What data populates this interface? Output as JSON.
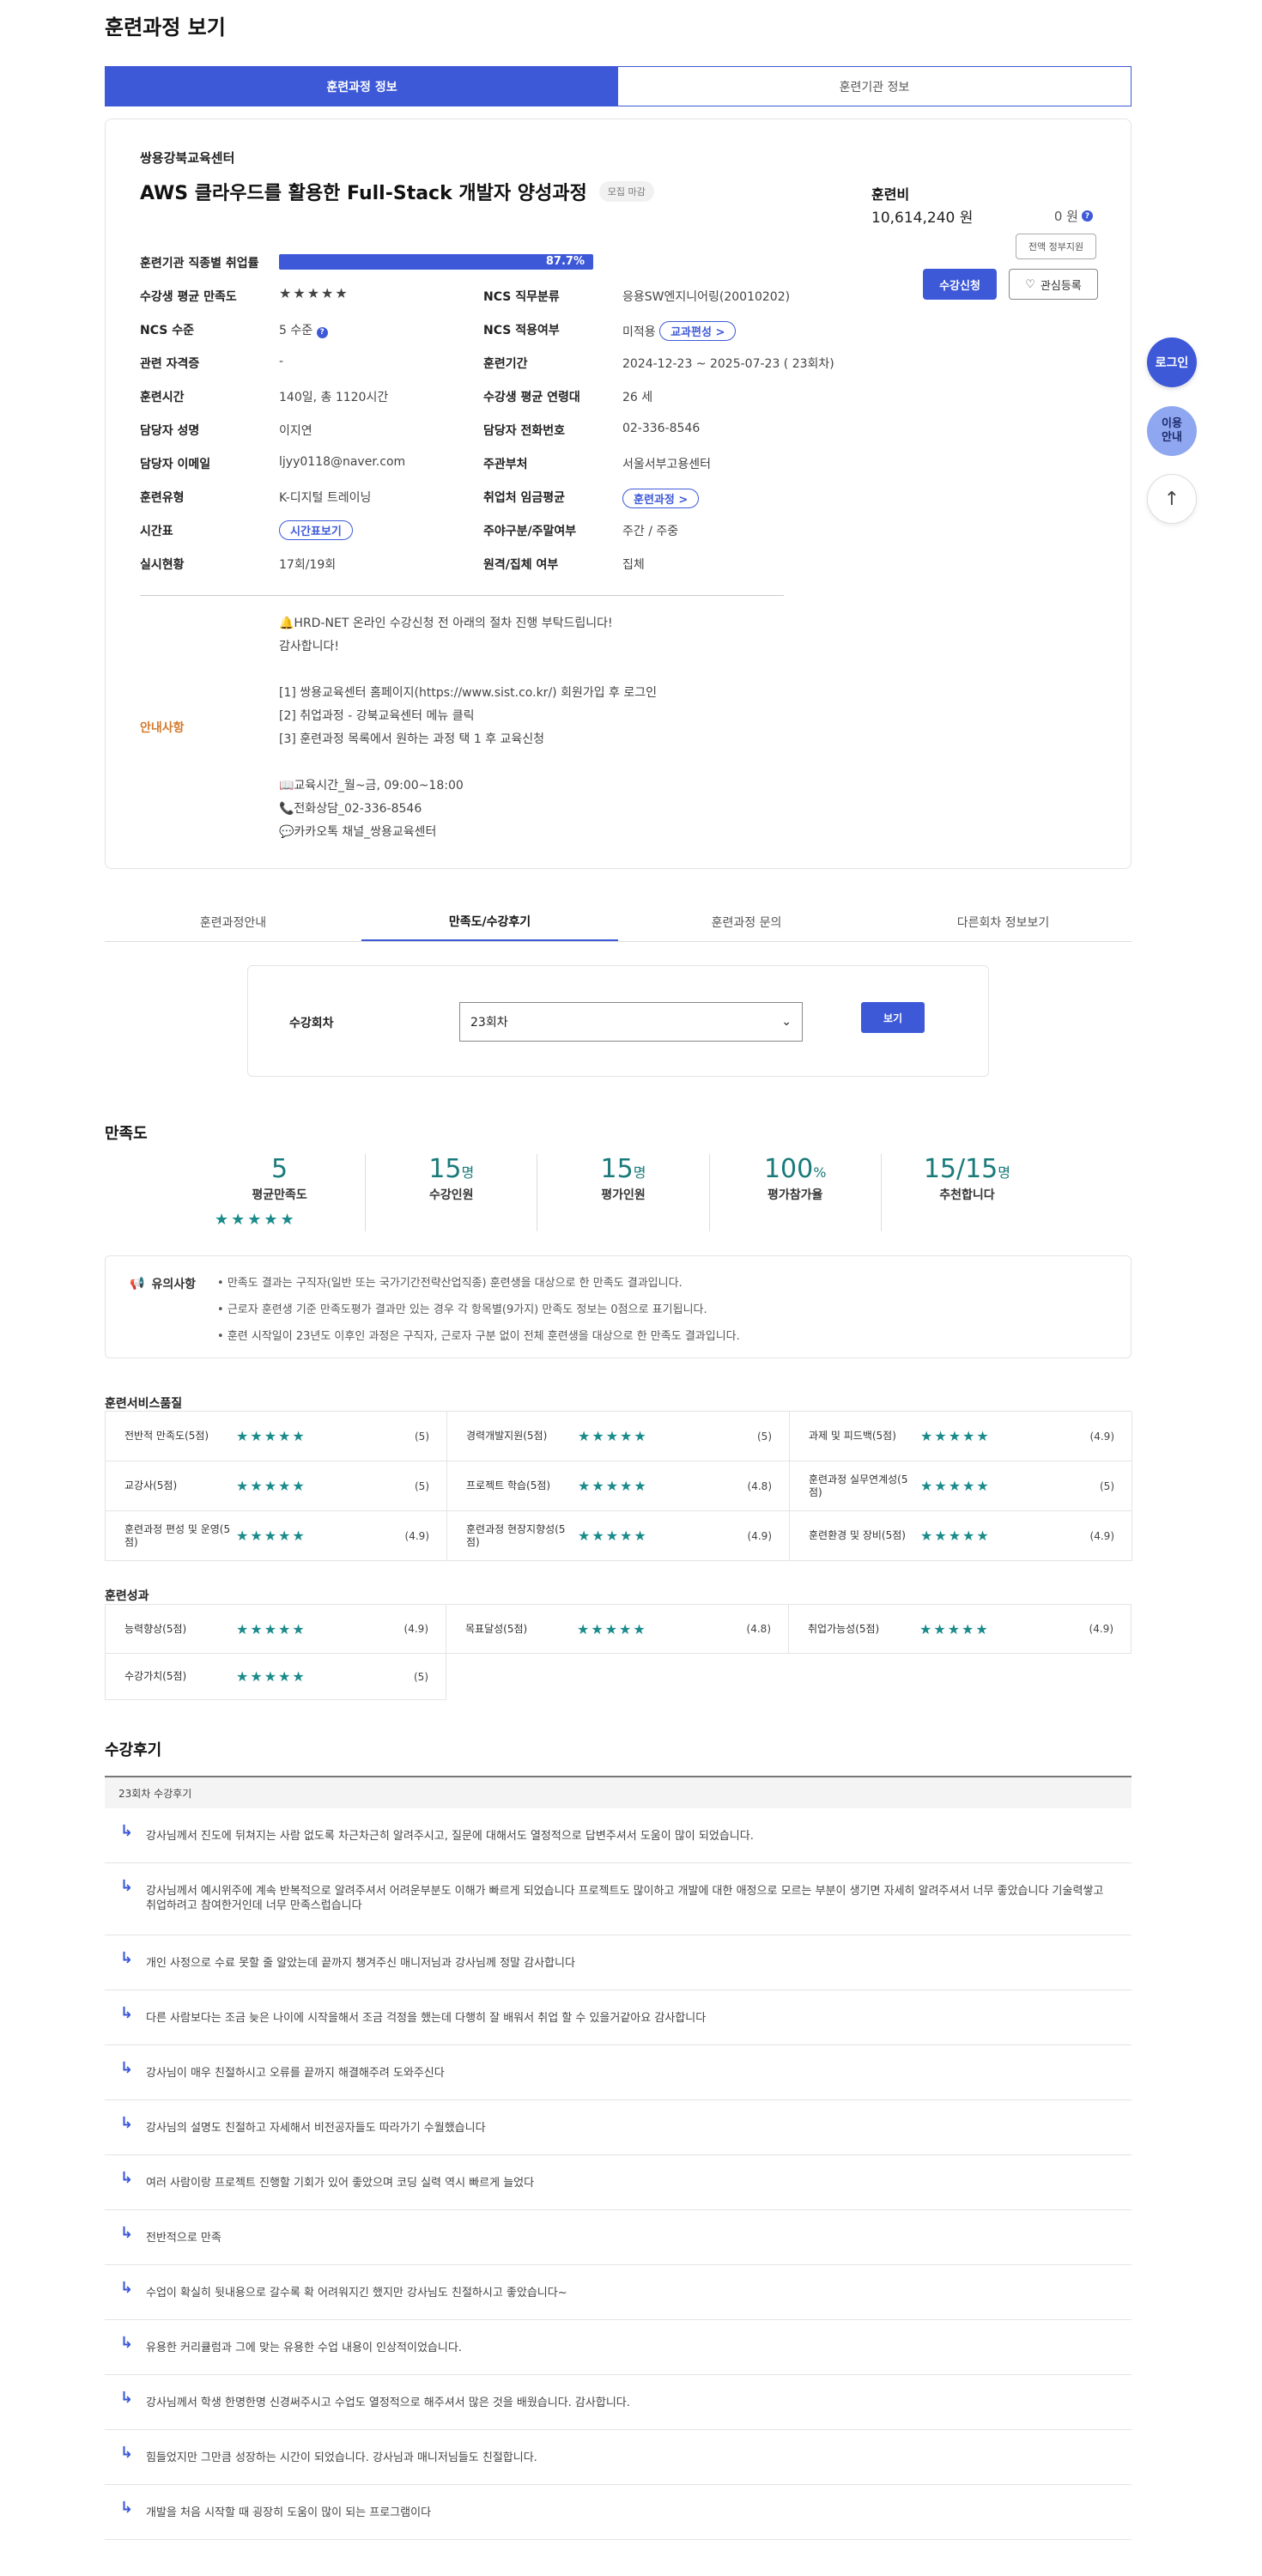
{
  "page_title": "훈련과정 보기",
  "top_tabs": [
    {
      "label": "훈련과정 정보",
      "active": true
    },
    {
      "label": "훈련기관 정보",
      "active": false
    }
  ],
  "course": {
    "org": "쌍용강북교육센터",
    "title": "AWS 클라우드를 활용한 Full-Stack 개발자 양성과정",
    "status_badge": "모집 마감",
    "fee_label": "훈련비",
    "fee_value": "10,614,240 원",
    "self_pay": "0 원",
    "full_support_label": "전액 정부지원",
    "apply_label": "수강신청",
    "fav_label": "관심등록"
  },
  "details": {
    "employment_rate_label": "훈련기관 직종별 취업률",
    "employment_rate": "87.7%",
    "employment_rate_value": 87.7,
    "satisfaction_label": "수강생 평균 만족도",
    "satisfaction_stars": "★★★★★",
    "ncs_field_label": "NCS 직무분류",
    "ncs_field": "응용SW엔지니어링(20010202)",
    "ncs_level_label": "NCS 수준",
    "ncs_level": "5 수준",
    "ncs_apply_label": "NCS 적용여부",
    "ncs_apply": "미적용",
    "curriculum_pill": "교과편성 >",
    "license_label": "관련 자격증",
    "license": "-",
    "period_label": "훈련기간",
    "period": "2024-12-23 ~ 2025-07-23 ( 23회차)",
    "hours_label": "훈련시간",
    "hours": "140일, 총 1120시간",
    "age_label": "수강생 평균 연령대",
    "age": "26 세",
    "manager_label": "담당자 성명",
    "manager": "이지연",
    "phone_label": "담당자 전화번호",
    "phone": "02-336-8546",
    "email_label": "담당자 이메일",
    "email": "ljyy0118@naver.com",
    "dept_label": "주관부처",
    "dept": "서울서부고용센터",
    "type_label": "훈련유형",
    "type": "K-디지털 트레이닝",
    "wage_label": "취업처 임금평균",
    "wage_pill": "훈련과정 >",
    "schedule_label": "시간표",
    "schedule_pill": "시간표보기",
    "daynight_label": "주야구분/주말여부",
    "daynight": "주간 / 주중",
    "status_label": "실시현황",
    "status": "17회/19회",
    "remote_label": "원격/집체 여부",
    "remote": "집체"
  },
  "notice": {
    "label": "안내사항",
    "lines": [
      "🔔HRD-NET 온라인 수강신청 전 아래의 절차 진행 부탁드립니다!",
      "감사합니다!",
      "",
      "[1] 쌍용교육센터 홈페이지(https://www.sist.co.kr/) 회원가입 후 로그인",
      "[2] 취업과정 - 강북교육센터 메뉴 클릭",
      "[3] 훈련과정 목록에서 원하는 과정 택 1 후 교육신청",
      "",
      "📖교육시간_월~금, 09:00~18:00",
      "📞전화상담_02-336-8546",
      "💬카카오톡 채널_쌍용교육센터"
    ]
  },
  "section_tabs": [
    {
      "label": "훈련과정안내",
      "active": false
    },
    {
      "label": "만족도/수강후기",
      "active": true
    },
    {
      "label": "훈련과정 문의",
      "active": false
    },
    {
      "label": "다른회차 정보보기",
      "active": false
    }
  ],
  "filter": {
    "label": "수강회차",
    "selected": "23회차",
    "button": "보기"
  },
  "satisfaction": {
    "title": "만족도",
    "stats": [
      {
        "num": "5",
        "unit": "",
        "label": "평균만족도"
      },
      {
        "num": "15",
        "unit": "명",
        "label": "수강인원"
      },
      {
        "num": "15",
        "unit": "명",
        "label": "평가인원"
      },
      {
        "num": "100",
        "unit": "%",
        "label": "평가참가율"
      },
      {
        "num": "15/15",
        "unit": "명",
        "label": "추천합니다"
      }
    ],
    "stars": "★★★★★"
  },
  "caution": {
    "title": "유의사항",
    "items": [
      "만족도 결과는 구직자(일반 또는 국가기간전략산업직종) 훈련생을 대상으로 한 만족도 결과입니다.",
      "근로자 훈련생 기준 만족도평가 결과만 있는 경우 각 항목별(9가지) 만족도 정보는 0점으로 표기됩니다.",
      "훈련 시작일이 23년도 이후인 과정은 구직자, 근로자 구분 없이 전체 훈련생을 대상으로 한 만족도 결과입니다."
    ]
  },
  "service_quality": {
    "title": "훈련서비스품질",
    "items": [
      {
        "label": "전반적 만족도(5점)",
        "score": "(5)"
      },
      {
        "label": "경력개발지원(5점)",
        "score": "(5)"
      },
      {
        "label": "과제 및 피드백(5점)",
        "score": "(4.9)"
      },
      {
        "label": "교강사(5점)",
        "score": "(5)"
      },
      {
        "label": "프로젝트 학습(5점)",
        "score": "(4.8)"
      },
      {
        "label": "훈련과정 실무연계성(5점)",
        "score": "(5)"
      },
      {
        "label": "훈련과정 편성 및 운영(5점)",
        "score": "(4.9)"
      },
      {
        "label": "훈련과정 현장지향성(5점)",
        "score": "(4.9)"
      },
      {
        "label": "훈련환경 및 장비(5점)",
        "score": "(4.9)"
      }
    ]
  },
  "outcomes": {
    "title": "훈련성과",
    "items": [
      {
        "label": "능력향상(5점)",
        "score": "(4.9)"
      },
      {
        "label": "목표달성(5점)",
        "score": "(4.8)"
      },
      {
        "label": "취업가능성(5점)",
        "score": "(4.9)"
      },
      {
        "label": "수강가치(5점)",
        "score": "(5)"
      }
    ]
  },
  "reviews": {
    "title": "수강후기",
    "head": "23회차 수강후기",
    "items": [
      "강사님께서 진도에 뒤쳐지는 사람 없도록 차근차근히 알려주시고, 질문에 대해서도 열정적으로 답변주셔서 도움이 많이 되었습니다.",
      "강사님께서 예시위주에 계속 반복적으로 알려주셔서 어려운부분도 이해가 빠르게 되었습니다 프로젝트도 많이하고 개발에 대한 애정으로 모르는 부분이 생기면 자세히 알려주셔서 너무 좋았습니다 기술력쌓고 취업하려고 참여한거인데 너무 만족스럽습니다",
      "개인 사정으로 수료 못할 줄 알았는데 끝까지 챙겨주신 매니저님과 강사님께 정말 감사합니다",
      "다른 사람보다는 조금 늦은 나이에 시작을해서 조금 걱정을 했는데 다행히 잘 배워서 취업 할 수 있을거같아요 감사합니다",
      "강사님이 매우 친절하시고 오류를 끝까지 해결해주려 도와주신다",
      "강사님의 설명도 친절하고 자세해서 비전공자들도 따라가기 수월했습니다",
      "여러 사람이랑 프로젝트 진행할 기회가 있어 좋았으며 코딩 실력 역시 빠르게 늘었다",
      "전반적으로 만족",
      "수업이 확실히 뒷내용으로 갈수록 확 어려워지긴 했지만 강사님도 친절하시고 좋았습니다~",
      "유용한 커리큘럼과 그에 맞는 유용한 수업 내용이 인상적이었습니다.",
      "강사님께서 학생 한명한명 신경써주시고 수업도 열정적으로 해주셔서 많은 것을 배웠습니다. 감사합니다.",
      "힘들었지만 그만큼 성장하는 시간이 되었습니다. 강사님과 매니저님들도 친절합니다.",
      "개발을 처음 시작할 때 굉장히 도움이 많이 되는 프로그램이다"
    ]
  },
  "side": {
    "login": "로그인",
    "guide_1": "이용",
    "guide_2": "안내",
    "top": "↑"
  }
}
